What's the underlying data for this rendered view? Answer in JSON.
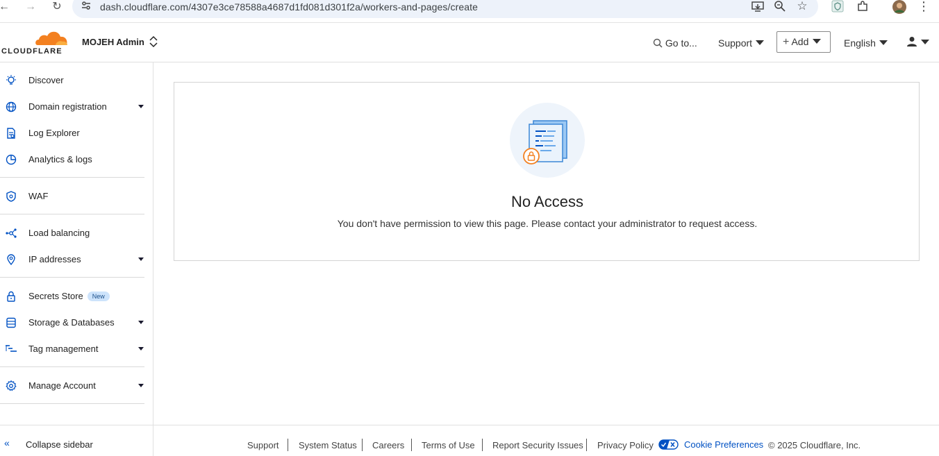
{
  "browser": {
    "url": "dash.cloudflare.com/4307e3ce78588a4687d1fd081d301f2a/workers-and-pages/create"
  },
  "header": {
    "logo_text": "CLOUDFLARE",
    "account_name": "MOJEH Admin",
    "goto_label": "Go to...",
    "support_label": "Support",
    "add_label": "Add",
    "language_label": "English"
  },
  "sidebar": {
    "items": [
      {
        "label": "Discover",
        "icon": "lightbulb-icon"
      },
      {
        "label": "Domain registration",
        "icon": "globe-icon"
      },
      {
        "label": "Log Explorer",
        "icon": "log-explorer-icon"
      },
      {
        "label": "Analytics & logs",
        "icon": "analytics-icon"
      },
      {
        "label": "WAF",
        "icon": "shield-icon"
      },
      {
        "label": "Load balancing",
        "icon": "load-balancing-icon"
      },
      {
        "label": "IP addresses",
        "icon": "location-pin-icon"
      },
      {
        "label": "Secrets Store",
        "icon": "lock-icon",
        "badge": "New"
      },
      {
        "label": "Storage & Databases",
        "icon": "database-icon"
      },
      {
        "label": "Tag management",
        "icon": "tag-management-icon"
      },
      {
        "label": "Manage Account",
        "icon": "gear-icon"
      }
    ],
    "collapse_label": "Collapse sidebar"
  },
  "main": {
    "title": "No Access",
    "description": "You don't have permission to view this page. Please contact your administrator to request access."
  },
  "footer": {
    "links": [
      "Support",
      "System Status",
      "Careers",
      "Terms of Use",
      "Report Security Issues",
      "Privacy Policy"
    ],
    "cookie_label": "Cookie Preferences",
    "copyright": "© 2025 Cloudflare, Inc."
  },
  "colors": {
    "accent": "#0051c3",
    "cloudflare_orange": "#f38020"
  }
}
